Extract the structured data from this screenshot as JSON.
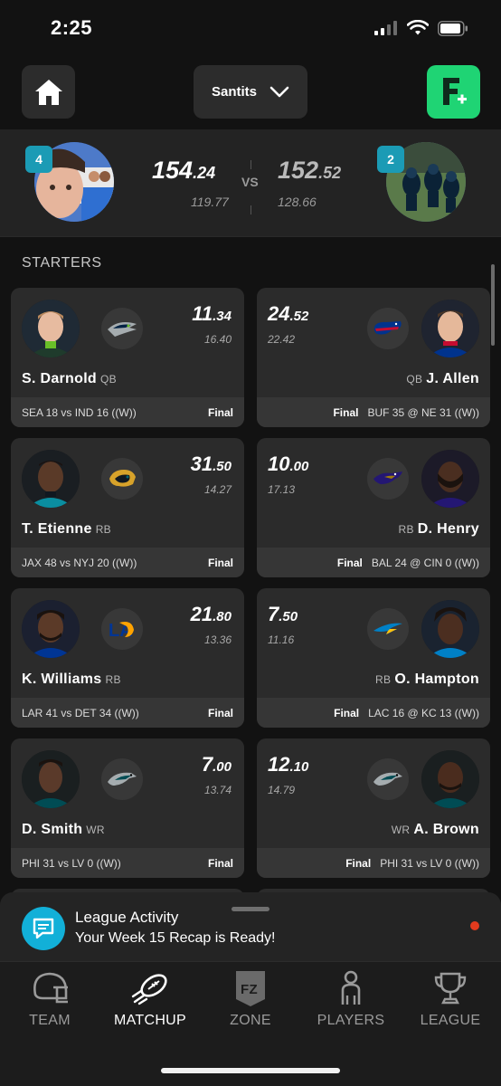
{
  "status_bar": {
    "time": "2:25"
  },
  "top_nav": {
    "league_name": "Santits"
  },
  "matchup": {
    "home": {
      "rank": "4",
      "score_int": "154",
      "score_dec": ".24",
      "projected": "119.77"
    },
    "vs_label": "VS",
    "away": {
      "rank": "2",
      "score_int": "152",
      "score_dec": ".52",
      "projected": "128.66"
    }
  },
  "section_label": "STARTERS",
  "starters": [
    {
      "left": {
        "name": "S. Darnold",
        "pos": "QB",
        "pts_int": "11",
        "pts_dec": ".34",
        "proj": "16.40",
        "game": "SEA 18 vs IND 16 ((W))",
        "status": "Final",
        "team_icon": "seahawks-logo-icon"
      },
      "right": {
        "name": "J. Allen",
        "pos": "QB",
        "pts_int": "24",
        "pts_dec": ".52",
        "proj": "22.42",
        "game": "BUF 35 @ NE 31 ((W))",
        "status": "Final",
        "team_icon": "bills-logo-icon"
      }
    },
    {
      "left": {
        "name": "T. Etienne",
        "pos": "RB",
        "pts_int": "31",
        "pts_dec": ".50",
        "proj": "14.27",
        "game": "JAX 48 vs NYJ 20 ((W))",
        "status": "Final",
        "team_icon": "jaguars-logo-icon"
      },
      "right": {
        "name": "D. Henry",
        "pos": "RB",
        "pts_int": "10",
        "pts_dec": ".00",
        "proj": "17.13",
        "game": "BAL 24 @ CIN 0 ((W))",
        "status": "Final",
        "team_icon": "ravens-logo-icon"
      }
    },
    {
      "left": {
        "name": "K. Williams",
        "pos": "RB",
        "pts_int": "21",
        "pts_dec": ".80",
        "proj": "13.36",
        "game": "LAR 41 vs DET 34 ((W))",
        "status": "Final",
        "team_icon": "rams-logo-icon"
      },
      "right": {
        "name": "O. Hampton",
        "pos": "RB",
        "pts_int": "7",
        "pts_dec": ".50",
        "proj": "11.16",
        "game": "LAC 16 @ KC 13 ((W))",
        "status": "Final",
        "team_icon": "chargers-logo-icon"
      }
    },
    {
      "left": {
        "name": "D. Smith",
        "pos": "WR",
        "pts_int": "7",
        "pts_dec": ".00",
        "proj": "13.74",
        "game": "PHI 31 vs LV 0 ((W))",
        "status": "Final",
        "team_icon": "eagles-logo-icon"
      },
      "right": {
        "name": "A. Brown",
        "pos": "WR",
        "pts_int": "12",
        "pts_dec": ".10",
        "proj": "14.79",
        "game": "PHI 31 vs LV 0 ((W))",
        "status": "Final",
        "team_icon": "eagles-logo-icon"
      }
    }
  ],
  "activity": {
    "title": "League Activity",
    "message": "Your Week 15 Recap is Ready!"
  },
  "tabs": [
    {
      "label": "TEAM",
      "icon": "helmet-icon"
    },
    {
      "label": "MATCHUP",
      "icon": "football-icon",
      "active": true
    },
    {
      "label": "ZONE",
      "icon": "fz-shield-icon"
    },
    {
      "label": "PLAYERS",
      "icon": "person-icon"
    },
    {
      "label": "LEAGUE",
      "icon": "trophy-icon"
    }
  ],
  "colors": {
    "accent_green": "#1fd474",
    "badge_teal": "#1b9bb5",
    "notification_red": "#e23b1e"
  }
}
